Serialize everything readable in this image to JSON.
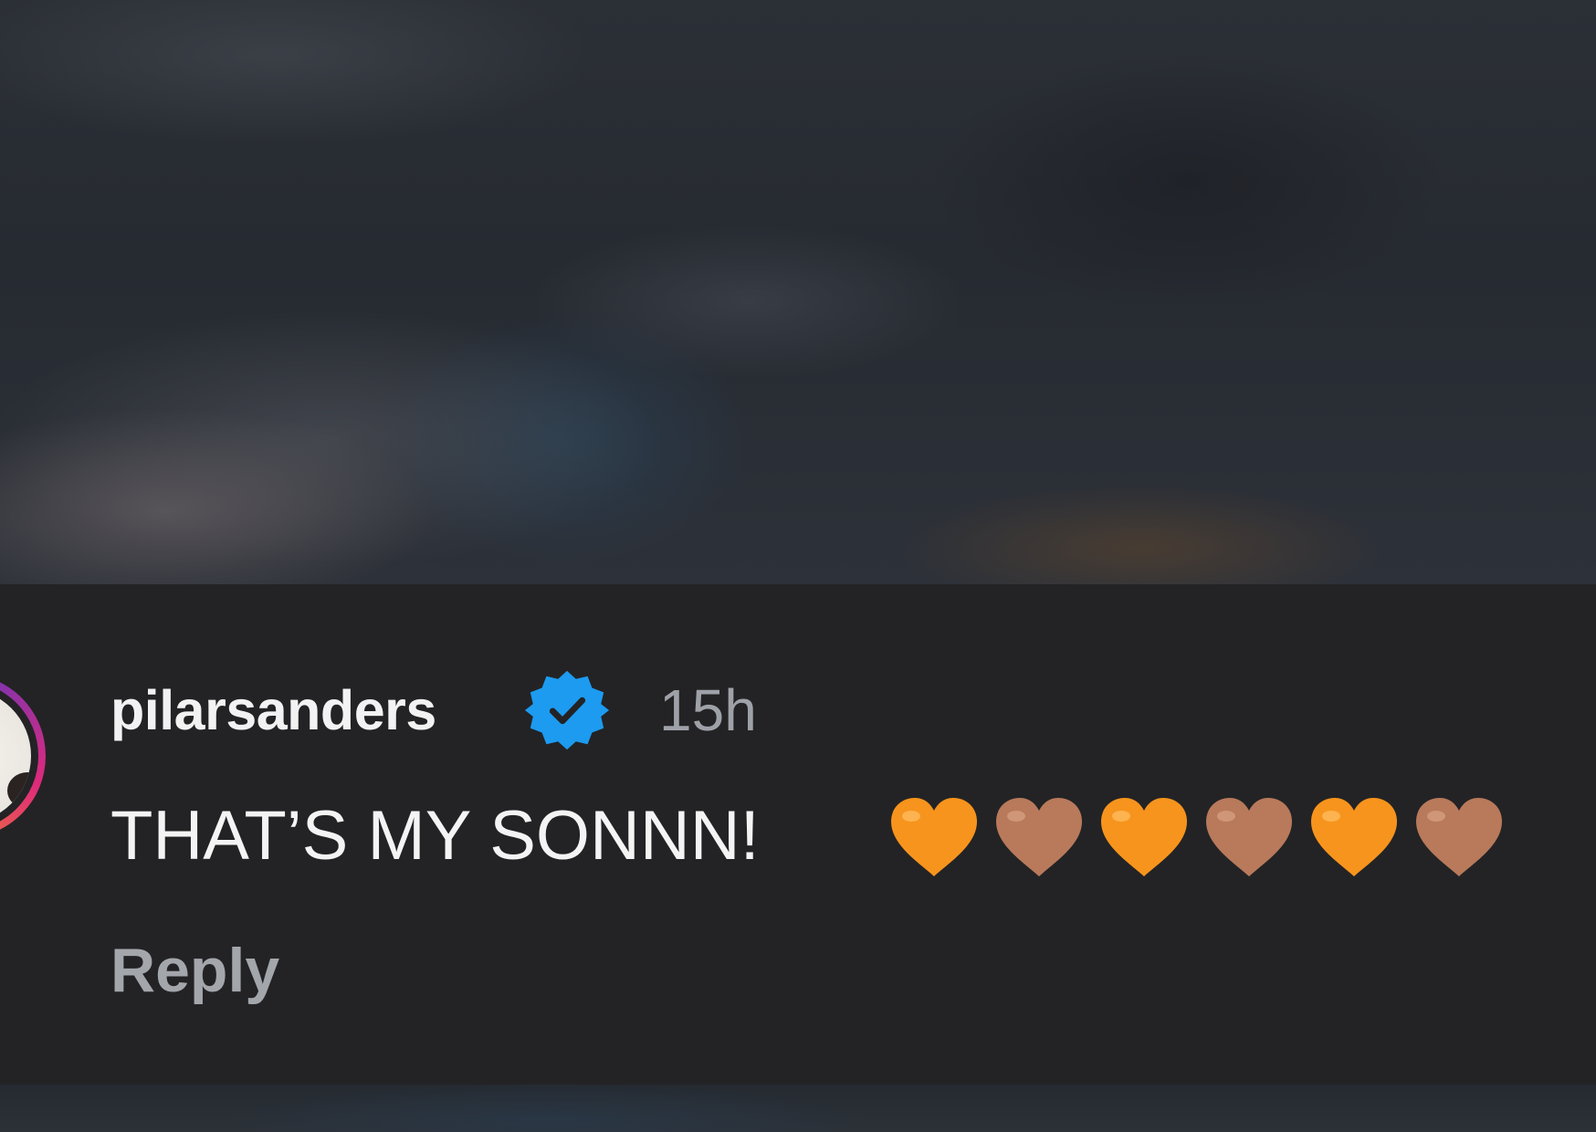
{
  "comment": {
    "username": "pilarsanders",
    "verified": true,
    "timestamp": "15h",
    "text": "THAT’S MY SONNN!",
    "emojis": [
      "orange-heart",
      "brown-heart",
      "orange-heart",
      "brown-heart",
      "orange-heart",
      "brown-heart"
    ],
    "reply_label": "Reply"
  },
  "colors": {
    "panel_background": "#232325",
    "username": "#f2f2f2",
    "timestamp": "#9ea2a8",
    "reply": "#a3a6ab",
    "verified_badge": "#1d9bf0",
    "orange_heart": "#f7941d",
    "brown_heart": "#b87a5b"
  }
}
